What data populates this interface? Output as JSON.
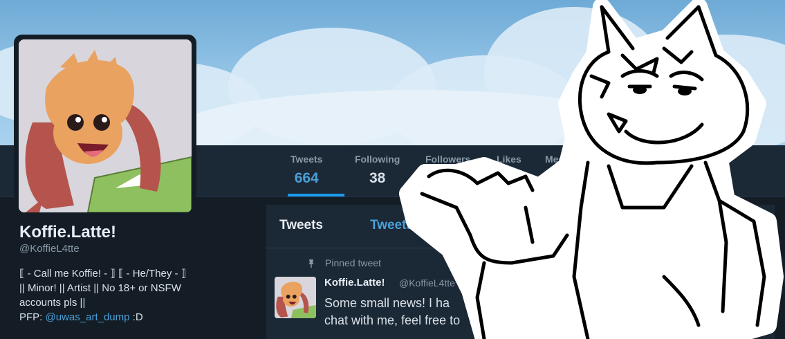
{
  "profile": {
    "name": "Koffie.Latte!",
    "handle": "@KoffieL4tte",
    "bio_lines": [
      "⟦ - Call me Koffie! - ⟧ ⟦ - He/They - ⟧",
      "|| Minor! || Artist || No 18+ or NSFW",
      "accounts pls ||"
    ],
    "pfp_prefix": "PFP: ",
    "pfp_link": "@uwas_art_dump",
    "pfp_suffix": " :D"
  },
  "stats": [
    {
      "label": "Tweets",
      "value": "664",
      "active": true
    },
    {
      "label": "Following",
      "value": "38",
      "active": false
    },
    {
      "label": "Followers",
      "value": "",
      "active": false
    },
    {
      "label": "Likes",
      "value": "",
      "active": false
    },
    {
      "label": "Media",
      "value": "",
      "active": false
    }
  ],
  "timeline": {
    "tabs": [
      "Tweets",
      "Tweets"
    ],
    "more_icon": "more-dots-icon",
    "pinned_label": "Pinned tweet",
    "tweet": {
      "name": "Koffie.Latte!",
      "handle": "@KoffieL4tte",
      "lines": [
        "Some small news! I ha",
        "chat with me, feel free to"
      ]
    }
  },
  "colors": {
    "accent": "#1d9bf0",
    "link": "#4a9fd6",
    "background": "#141d26",
    "panel": "#1b2836",
    "muted_text": "#8899a6"
  }
}
